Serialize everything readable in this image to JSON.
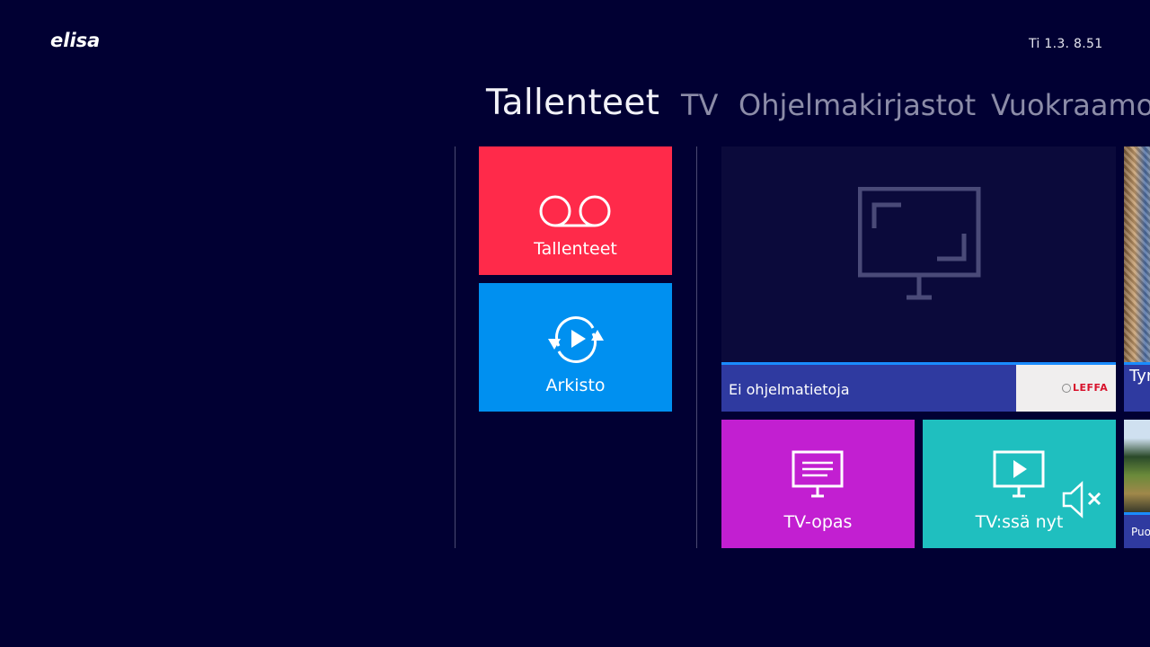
{
  "header": {
    "logo": "elisa",
    "clock": "Ti 1.3. 8.51"
  },
  "nav": {
    "tabs": [
      {
        "label": "Tallenteet",
        "active": true
      },
      {
        "label": "TV",
        "active": false
      },
      {
        "label": "Ohjelmakirjastot",
        "active": false
      },
      {
        "label": "Vuokraamo",
        "active": false
      }
    ]
  },
  "tiles": {
    "recordings": {
      "label": "Tallenteet",
      "icon": "voicemail-icon",
      "color": "#ff2a4a"
    },
    "archive": {
      "label": "Arkisto",
      "icon": "archive-replay-icon",
      "color": "#0090f0"
    },
    "player": {
      "info": "Ei ohjelmatietoja",
      "channel_logo": "LEFFA",
      "icon": "tv-screen-icon"
    },
    "guide": {
      "label": "TV-opas",
      "icon": "tv-guide-icon",
      "color": "#c21fd1"
    },
    "now": {
      "label": "TV:ssä nyt",
      "icon": "tv-play-icon",
      "status_icon": "mute-icon",
      "color": "#1fbfbf"
    },
    "peek_top": {
      "text": "Tyr"
    },
    "peek_bottom": {
      "text": "Puo"
    }
  }
}
